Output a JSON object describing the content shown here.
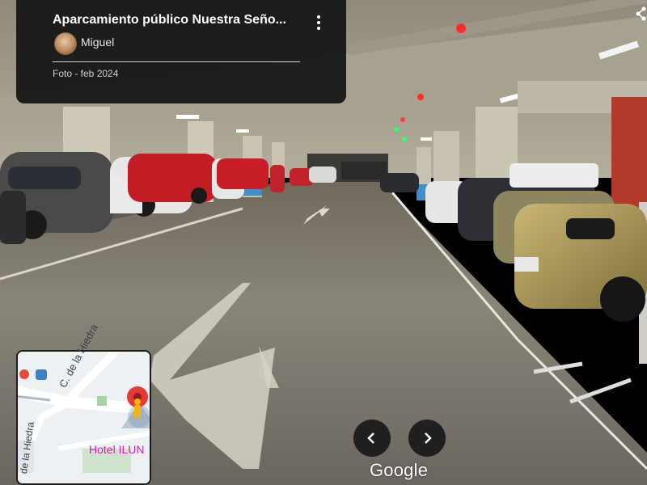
{
  "info_card": {
    "title": "Aparcamiento público Nuestra Seño...",
    "author": "Miguel",
    "photo_date": "Foto - feb 2024"
  },
  "minimap": {
    "street_1": "C. de la Hiedra",
    "street_2": "de la Hiedra",
    "place_label": "Hotel ILUN"
  },
  "navigation": {
    "prev_icon": "chevron-left-icon",
    "next_icon": "chevron-right-icon"
  },
  "branding": {
    "logo_text": "Google"
  },
  "icons": {
    "menu": "more-vert-icon",
    "share": "share-icon",
    "pegman": "pegman-icon"
  },
  "colors": {
    "pin_red": "#e53935",
    "pegman_yellow": "#f5b800",
    "hotel_label": "#c724b1",
    "card_bg": "#121212"
  }
}
